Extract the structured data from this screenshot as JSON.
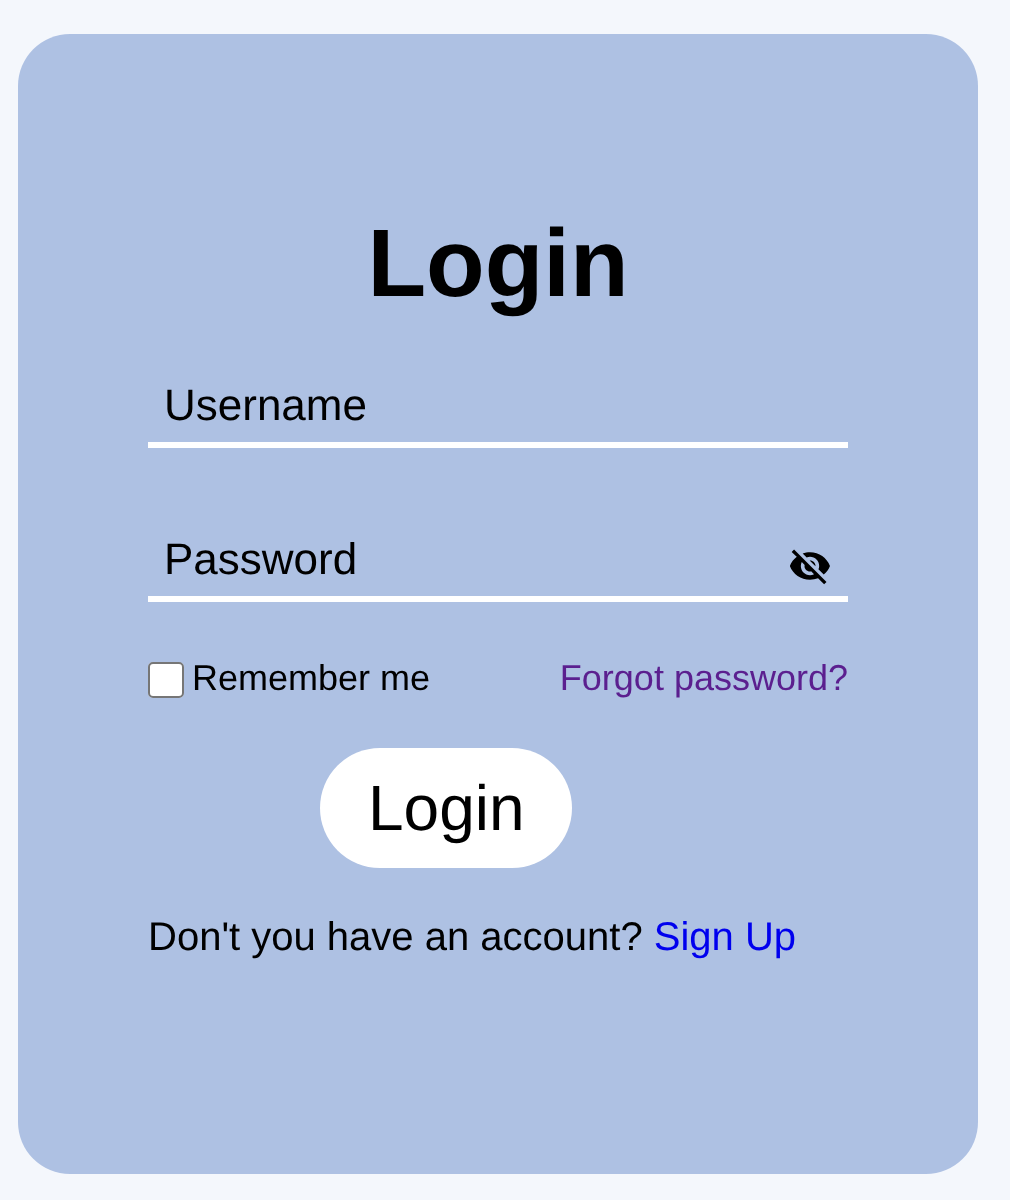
{
  "title": "Login",
  "fields": [
    {
      "placeholder": "Username",
      "kind": "text"
    },
    {
      "placeholder": "Password",
      "kind": "password"
    }
  ],
  "remember": {
    "label": "Remember me",
    "checked": false
  },
  "forgot_link": "Forgot password?",
  "submit": "Login",
  "signup": {
    "text": "Don't you have an account?",
    "link": "Sign Up"
  }
}
